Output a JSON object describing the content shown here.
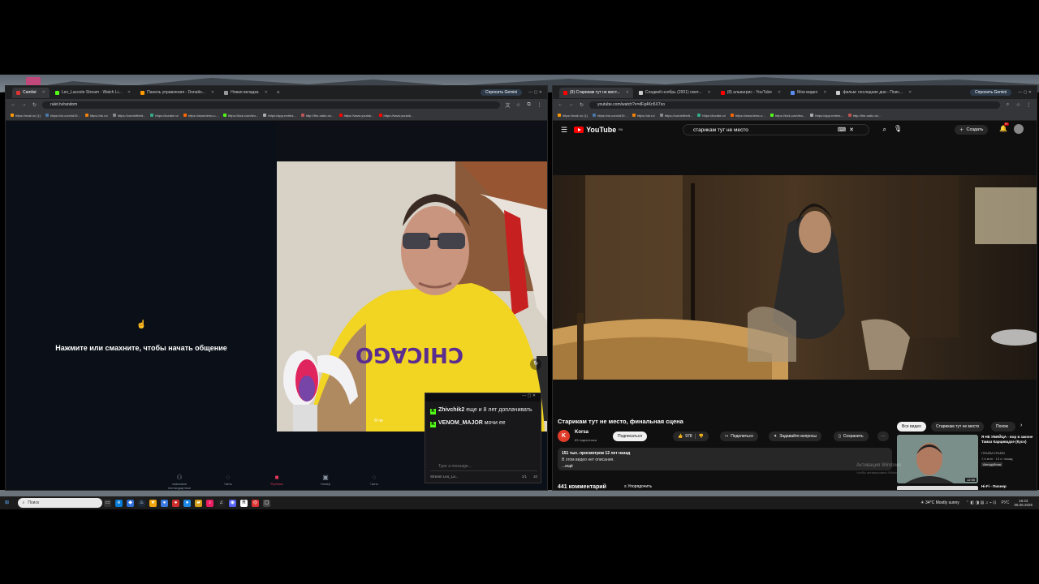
{
  "left_browser": {
    "tabs": [
      {
        "label": "Camlist",
        "color": "#d33"
      },
      {
        "label": "Leo_Lacoste Stream - Watch Li...",
        "color": "#53fc18"
      },
      {
        "label": "Панель управления - Donatio...",
        "color": "#f90"
      },
      {
        "label": "Новая вкладка",
        "color": "#999"
      }
    ],
    "new_tab": "+",
    "url": "rulet.tv/random",
    "gemini_label": "Спросить Gemini",
    "bookmarks": [
      "https://mail.ru/ (1)",
      "https://vk.com/id19...",
      "https://ok.ru/",
      "https://vorobrfbett...",
      "https://korabl.ru/",
      "https://www.temu.c...",
      "https://kick.com/leo...",
      "https://app.redres...",
      "http://the-radio.ru/...",
      "https://www.youtub...",
      "https://www.youtub..."
    ]
  },
  "ruletka": {
    "start_text": "Нажмите или смахните, чтобы начать общение",
    "nav": [
      "знакомые нестандартные",
      "Чаты",
      "Рулетка",
      "Номер",
      "Чаты"
    ],
    "cam_overlay_text": "Я ли"
  },
  "chat": {
    "messages": [
      {
        "user": "Zhivchik2",
        "text": "еще и 8 лет доплачивать"
      },
      {
        "user": "VENOM_MAJOR",
        "text": "мочи ее"
      }
    ],
    "placeholder": "Type a message...",
    "footer_name": "Stream Leo_La...",
    "footer_stats": [
      "1/1",
      "10"
    ]
  },
  "right_browser": {
    "tabs": [
      {
        "label": "(9) Старикам тут не мест...",
        "color": "#f00"
      },
      {
        "label": "Сладкий ноябрь (2001) смот...",
        "color": "#ccc"
      },
      {
        "label": "(8) альвагрис - YouTube",
        "color": "#f00"
      },
      {
        "label": "Мои видео",
        "color": "#5a8dee"
      },
      {
        "label": "фильм: последние дни - Поис...",
        "color": "#ccc"
      }
    ],
    "gemini_label": "Спросить Gemini",
    "url": "youtube.com/watch?v=dFg4Kn5X7xo",
    "bookmarks": [
      "https://mail.ru/ (1)",
      "https://vk.com/id19...",
      "https://ok.ru/",
      "https://vorobrfbett...",
      "https://korabl.ru/",
      "https://www.temu.c...",
      "https://kick.com/leo...",
      "https://app.redres...",
      "http://the-radio.ru/..."
    ]
  },
  "youtube": {
    "logo": "YouTube",
    "logo_badge": "RU",
    "search_query": "старикам тут не место",
    "create_label": "Создать",
    "notif_count": "9+",
    "title": "Старикам тут не место, финальная сцена",
    "channel": "Korsa",
    "channel_initial": "K",
    "subscribers": "83 подписчика",
    "subscribe": "Подписаться",
    "likes": "978",
    "share": "Поделиться",
    "ask": "Задавайте вопросы",
    "save": "Сохранить",
    "views": "151 тыс. просмотров  12 лет назад",
    "no_description": "В этом видео нет описания.",
    "more": "...ещё",
    "comments": "441 комментарий",
    "sort": "Упорядочить",
    "chips": [
      "Все видео",
      "Старикам тут не место",
      "Похож"
    ],
    "rec": {
      "title": "Я НЕ УБИЙЦА - вор в законе Тамаз Карцивадзе (Кусо)",
      "channel": "ПРАЙМ КРАЙМ",
      "meta": "7,4 млн · 13 л. назад",
      "badge": "Автодубляж",
      "duration": "12:55",
      "next_title": "Hi-Fi - Пионер"
    },
    "activation": [
      "Активация Windows",
      "Чтобы активировать Windows, перейдите в раздел «Параметры»."
    ]
  },
  "taskbar": {
    "search_placeholder": "Поиск",
    "weather": "34°C  Mostly sunny",
    "lang": "РУС",
    "time": "16:23",
    "date": "06.06.2025"
  }
}
